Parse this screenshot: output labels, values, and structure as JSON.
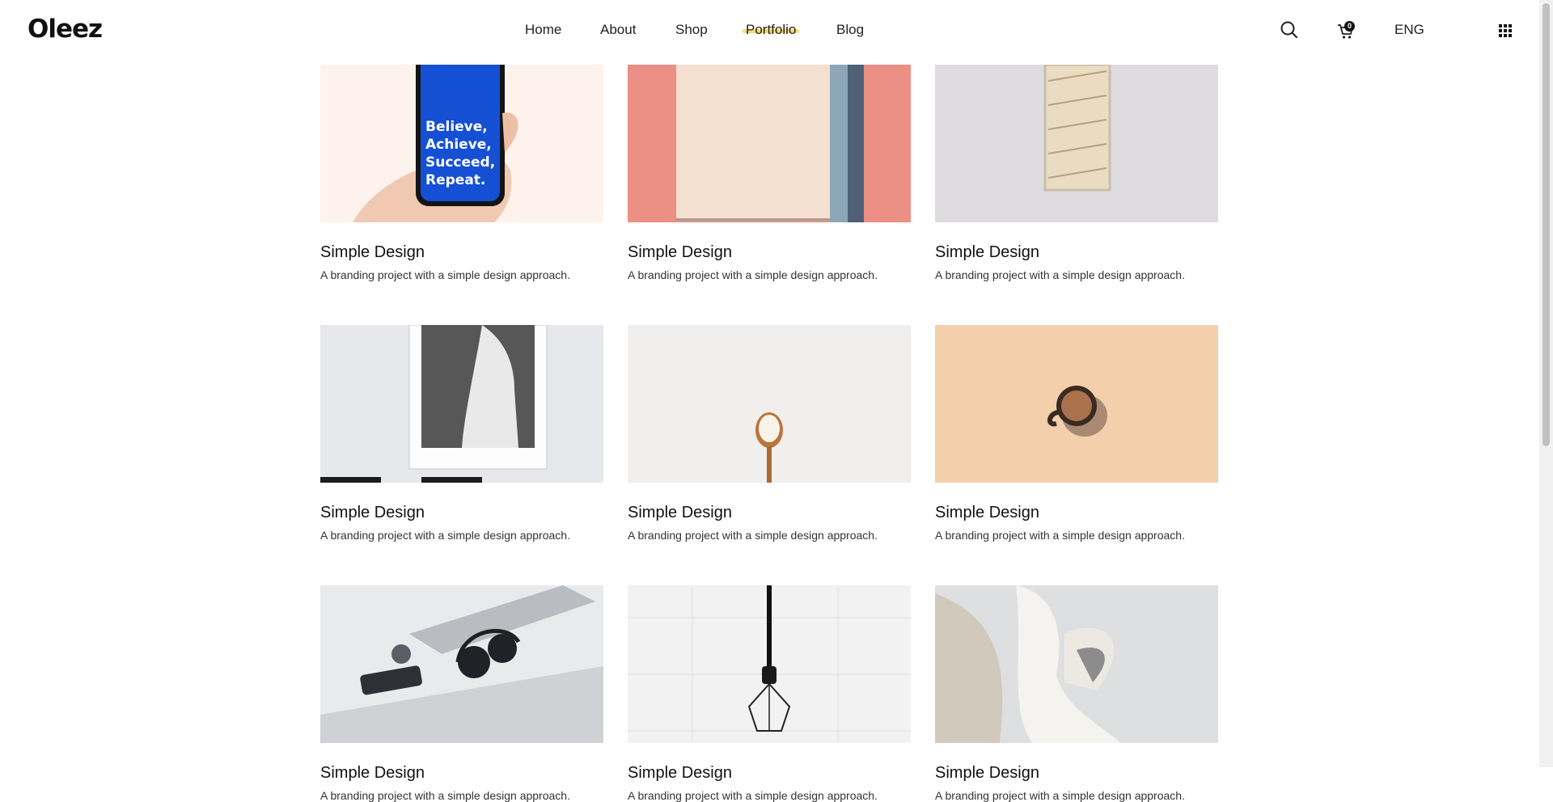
{
  "brand": "Oleez",
  "nav": {
    "items": [
      {
        "label": "Home",
        "active": false
      },
      {
        "label": "About",
        "active": false
      },
      {
        "label": "Shop",
        "active": false
      },
      {
        "label": "Portfolio",
        "active": true
      },
      {
        "label": "Blog",
        "active": false
      }
    ]
  },
  "header": {
    "search_icon": "search-icon",
    "cart_icon": "cart-icon",
    "cart_count": "0",
    "language": "ENG",
    "menu_icon": "grid-menu-icon"
  },
  "colors": {
    "accent_highlight": "#f3dc6b"
  },
  "portfolio": {
    "cards": [
      {
        "title": "Simple Design",
        "desc": "A branding project with a simple design approach.",
        "image": "hand holding phone with blue screen"
      },
      {
        "title": "Simple Design",
        "desc": "A branding project with a simple design approach.",
        "image": "beige paper on pink and blue background"
      },
      {
        "title": "Simple Design",
        "desc": "A branding project with a simple design approach.",
        "image": "staircase through narrow window"
      },
      {
        "title": "Simple Design",
        "desc": "A branding project with a simple design approach.",
        "image": "framed photo of person in white hoodie"
      },
      {
        "title": "Simple Design",
        "desc": "A branding project with a simple design approach.",
        "image": "wooden spoon with rice"
      },
      {
        "title": "Simple Design",
        "desc": "A branding project with a simple design approach.",
        "image": "coffee cup on peach background"
      },
      {
        "title": "Simple Design",
        "desc": "A branding project with a simple design approach.",
        "image": "headphones phone and watch on desk"
      },
      {
        "title": "Simple Design",
        "desc": "A branding project with a simple design approach.",
        "image": "hanging geometric pendant lamp"
      },
      {
        "title": "Simple Design",
        "desc": "A branding project with a simple design approach.",
        "image": "white curved architecture"
      }
    ]
  },
  "phone_text": [
    "Believe,",
    "Achieve,",
    "Succeed,",
    "Repeat."
  ]
}
